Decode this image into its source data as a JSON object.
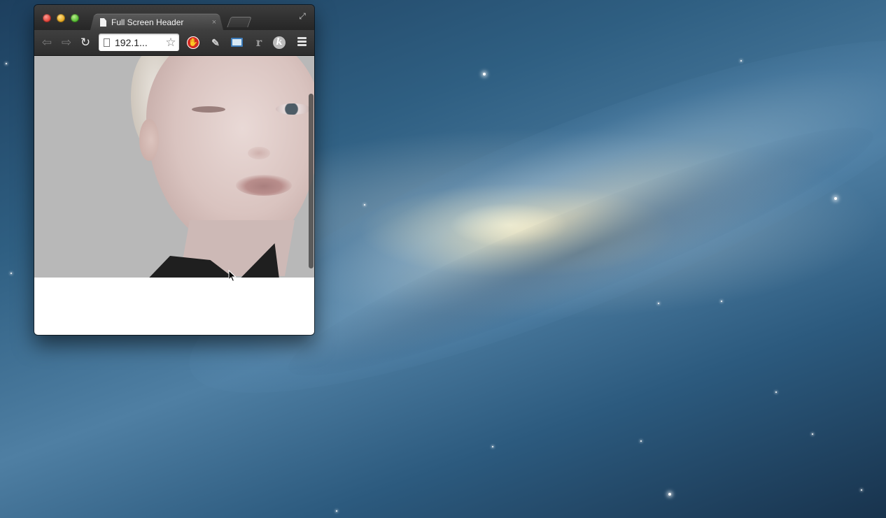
{
  "window": {
    "tab_title": "Full Screen Header",
    "tab_close_glyph": "×"
  },
  "toolbar": {
    "back_icon": "back-arrow-icon",
    "forward_icon": "forward-arrow-icon",
    "reload_icon": "reload-icon",
    "url_text": "192.1...",
    "star_icon": "bookmark-star-icon",
    "extensions": [
      "adblock-icon",
      "pen-icon",
      "screenshot-icon",
      "r-icon",
      "k-icon"
    ],
    "ext_k_label": "k",
    "ext_r_label": "r",
    "menu_icon": "hamburger-menu-icon"
  },
  "colors": {
    "desktop_accent": "#2f5f82",
    "hero_background": "#b8b8b8",
    "page_background": "#ffffff",
    "adblock_red": "#d42b21"
  }
}
